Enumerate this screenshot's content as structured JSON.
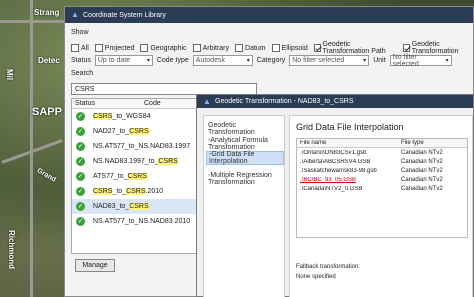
{
  "map": {
    "labels": [
      "Strang",
      "Mil",
      "Detec",
      "SAPP",
      "Grand",
      "Richmond"
    ]
  },
  "window": {
    "title": "Coordinate System Library"
  },
  "show": {
    "label": "Show",
    "checks": [
      {
        "label": "All",
        "checked": false
      },
      {
        "label": "Projected",
        "checked": false
      },
      {
        "label": "Geographic",
        "checked": false
      },
      {
        "label": "Arbitrary",
        "checked": false
      },
      {
        "label": "Datum",
        "checked": false
      },
      {
        "label": "Ellipsoid",
        "checked": false
      },
      {
        "label": "Geodetic Transformation Path",
        "checked": true
      },
      {
        "label": "Geodetic Transformation",
        "checked": true
      }
    ]
  },
  "filters": {
    "status_label": "Status",
    "status_value": "Up to date",
    "code_type_label": "Code type",
    "code_type_value": "Autodesk",
    "category_label": "Category",
    "category_value": "No filter selected",
    "unit_label": "Unit",
    "unit_value": "No filter selected"
  },
  "search": {
    "label": "Search",
    "value": "CSRS"
  },
  "list": {
    "col_status": "Status",
    "col_code": "Code",
    "rows": [
      {
        "code": "CSRS_to_WGS84"
      },
      {
        "code": "NAD27_to_CSRS"
      },
      {
        "code": "NS.AT577_to_NS.NAD83.1997"
      },
      {
        "code": "NS.NAD83.1997_to_CSRS"
      },
      {
        "code": "ATS77_to_CSRS"
      },
      {
        "code": "CSRS_to_CSRS.2010"
      },
      {
        "code": "NAD83_to_CSRS"
      },
      {
        "code": "NS.AT577_to_NS.NAD83.2010"
      }
    ]
  },
  "manage_button": "Manage",
  "dialog": {
    "title": "Geodetic Transformation - NAD83_to_CSRS",
    "nav": {
      "root": "Geodetic Transformation",
      "items": [
        "-Analytical Formula Transformation",
        "-Grid Data File Interpolation",
        "-Multiple Regression Transformation"
      ]
    },
    "heading": "Grid Data File Interpolation",
    "table": {
      "col_file": "File name",
      "col_type": "File type",
      "rows": [
        {
          "file": ".\\Ontario\\ON83CSv1.gsb",
          "type": "Canadian NTv2"
        },
        {
          "file": ".\\Alberta\\ABCSRSV4.GSB",
          "type": "Canadian NTv2"
        },
        {
          "file": ".\\Saskatchewan\\sk83-98.gsb",
          "type": "Canadian NTv2"
        },
        {
          "file": ".\\BC\\BC_93_05.GSB",
          "type": "Canadian NTv2"
        },
        {
          "file": ".\\Canada\\NTV2_0.GSB",
          "type": "Canadian NTv2"
        }
      ]
    },
    "fallback_label": "Fallback transformation:",
    "fallback_value": "None specified"
  }
}
